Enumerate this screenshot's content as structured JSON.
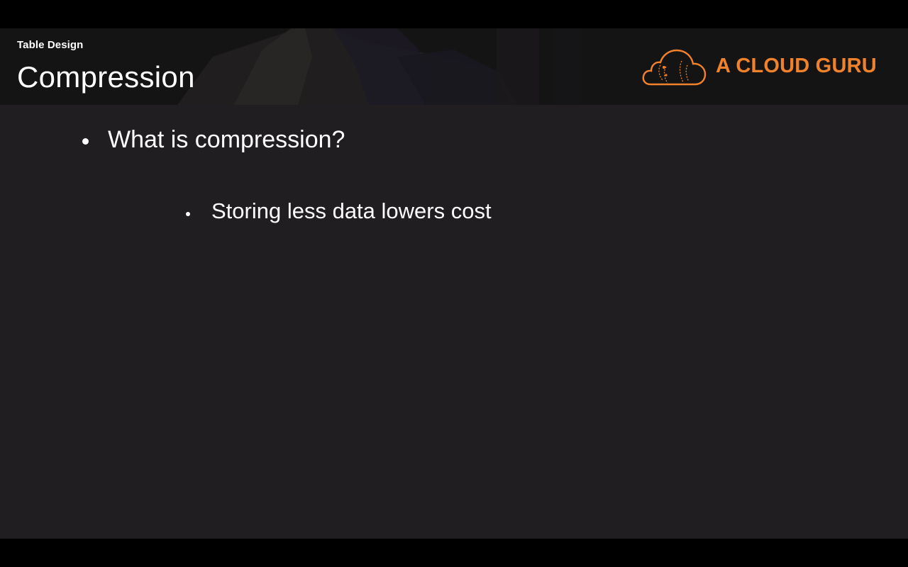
{
  "slide": {
    "section": "Table Design",
    "title": "Compression",
    "brand": {
      "name": "A CLOUD GURU",
      "icon": "cloud-logo-icon",
      "color": "#f0822c"
    },
    "bullets": [
      {
        "level": 1,
        "text": "What is compression?"
      },
      {
        "level": 2,
        "text": "Storing less data lowers cost"
      }
    ]
  },
  "colors": {
    "background": "#201e21",
    "letterbox": "#000000",
    "text": "#ffffff"
  }
}
